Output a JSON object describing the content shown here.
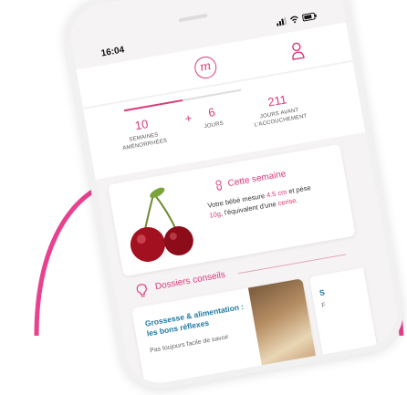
{
  "colors": {
    "accent": "#d93b7d",
    "link": "#1e7aa3"
  },
  "status": {
    "time": "16:04",
    "icons": [
      "signal-icon",
      "wifi-icon",
      "battery-icon"
    ]
  },
  "appbar": {
    "logo_glyph": "m",
    "icons": [
      "logo-icon",
      "user-icon"
    ]
  },
  "stats": {
    "progress": 0.5,
    "weeks": {
      "value": "10",
      "label": "SEMAINES AMÉNORRHÉES"
    },
    "plus": "+",
    "days": {
      "value": "6",
      "label": "JOURS"
    },
    "remaining": {
      "value": "211",
      "label": "JOURS AVANT L'ACCOUCHEMENT"
    }
  },
  "week_card": {
    "title": "Cette semaine",
    "text_1": "Votre bébé mesure ",
    "size": "4.5 cm",
    "text_2": " et pèse ",
    "weight": "10g",
    "text_3": ", l'équivalent d'une ",
    "fruit": "cerise",
    "text_4": "."
  },
  "section": {
    "title": "Dossiers conseils"
  },
  "articles": [
    {
      "title": "Grossesse & alimentation : les bons réflexes",
      "desc": "Pas toujours facile de savoir"
    },
    {
      "title": "S",
      "desc": "F"
    }
  ]
}
